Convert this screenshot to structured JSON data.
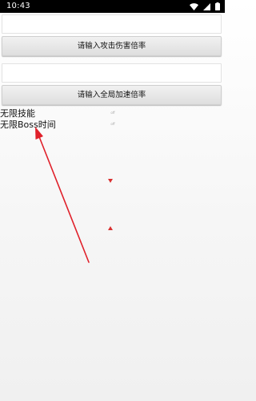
{
  "status_bar": {
    "time": "10:43"
  },
  "attack_panel": {
    "input_value": "",
    "button_label": "请输入攻击伤害倍率"
  },
  "speed_panel": {
    "input_value": "",
    "button_label": "请输入全局加速倍率"
  },
  "features": [
    {
      "label": "无限技能",
      "state": "off"
    },
    {
      "label": "无限Boss时间",
      "state": "off"
    }
  ],
  "annotation": {
    "arrow_color": "#e0202a"
  },
  "colors": {
    "status_bar_bg": "#000000",
    "marker_red": "#d93030"
  }
}
